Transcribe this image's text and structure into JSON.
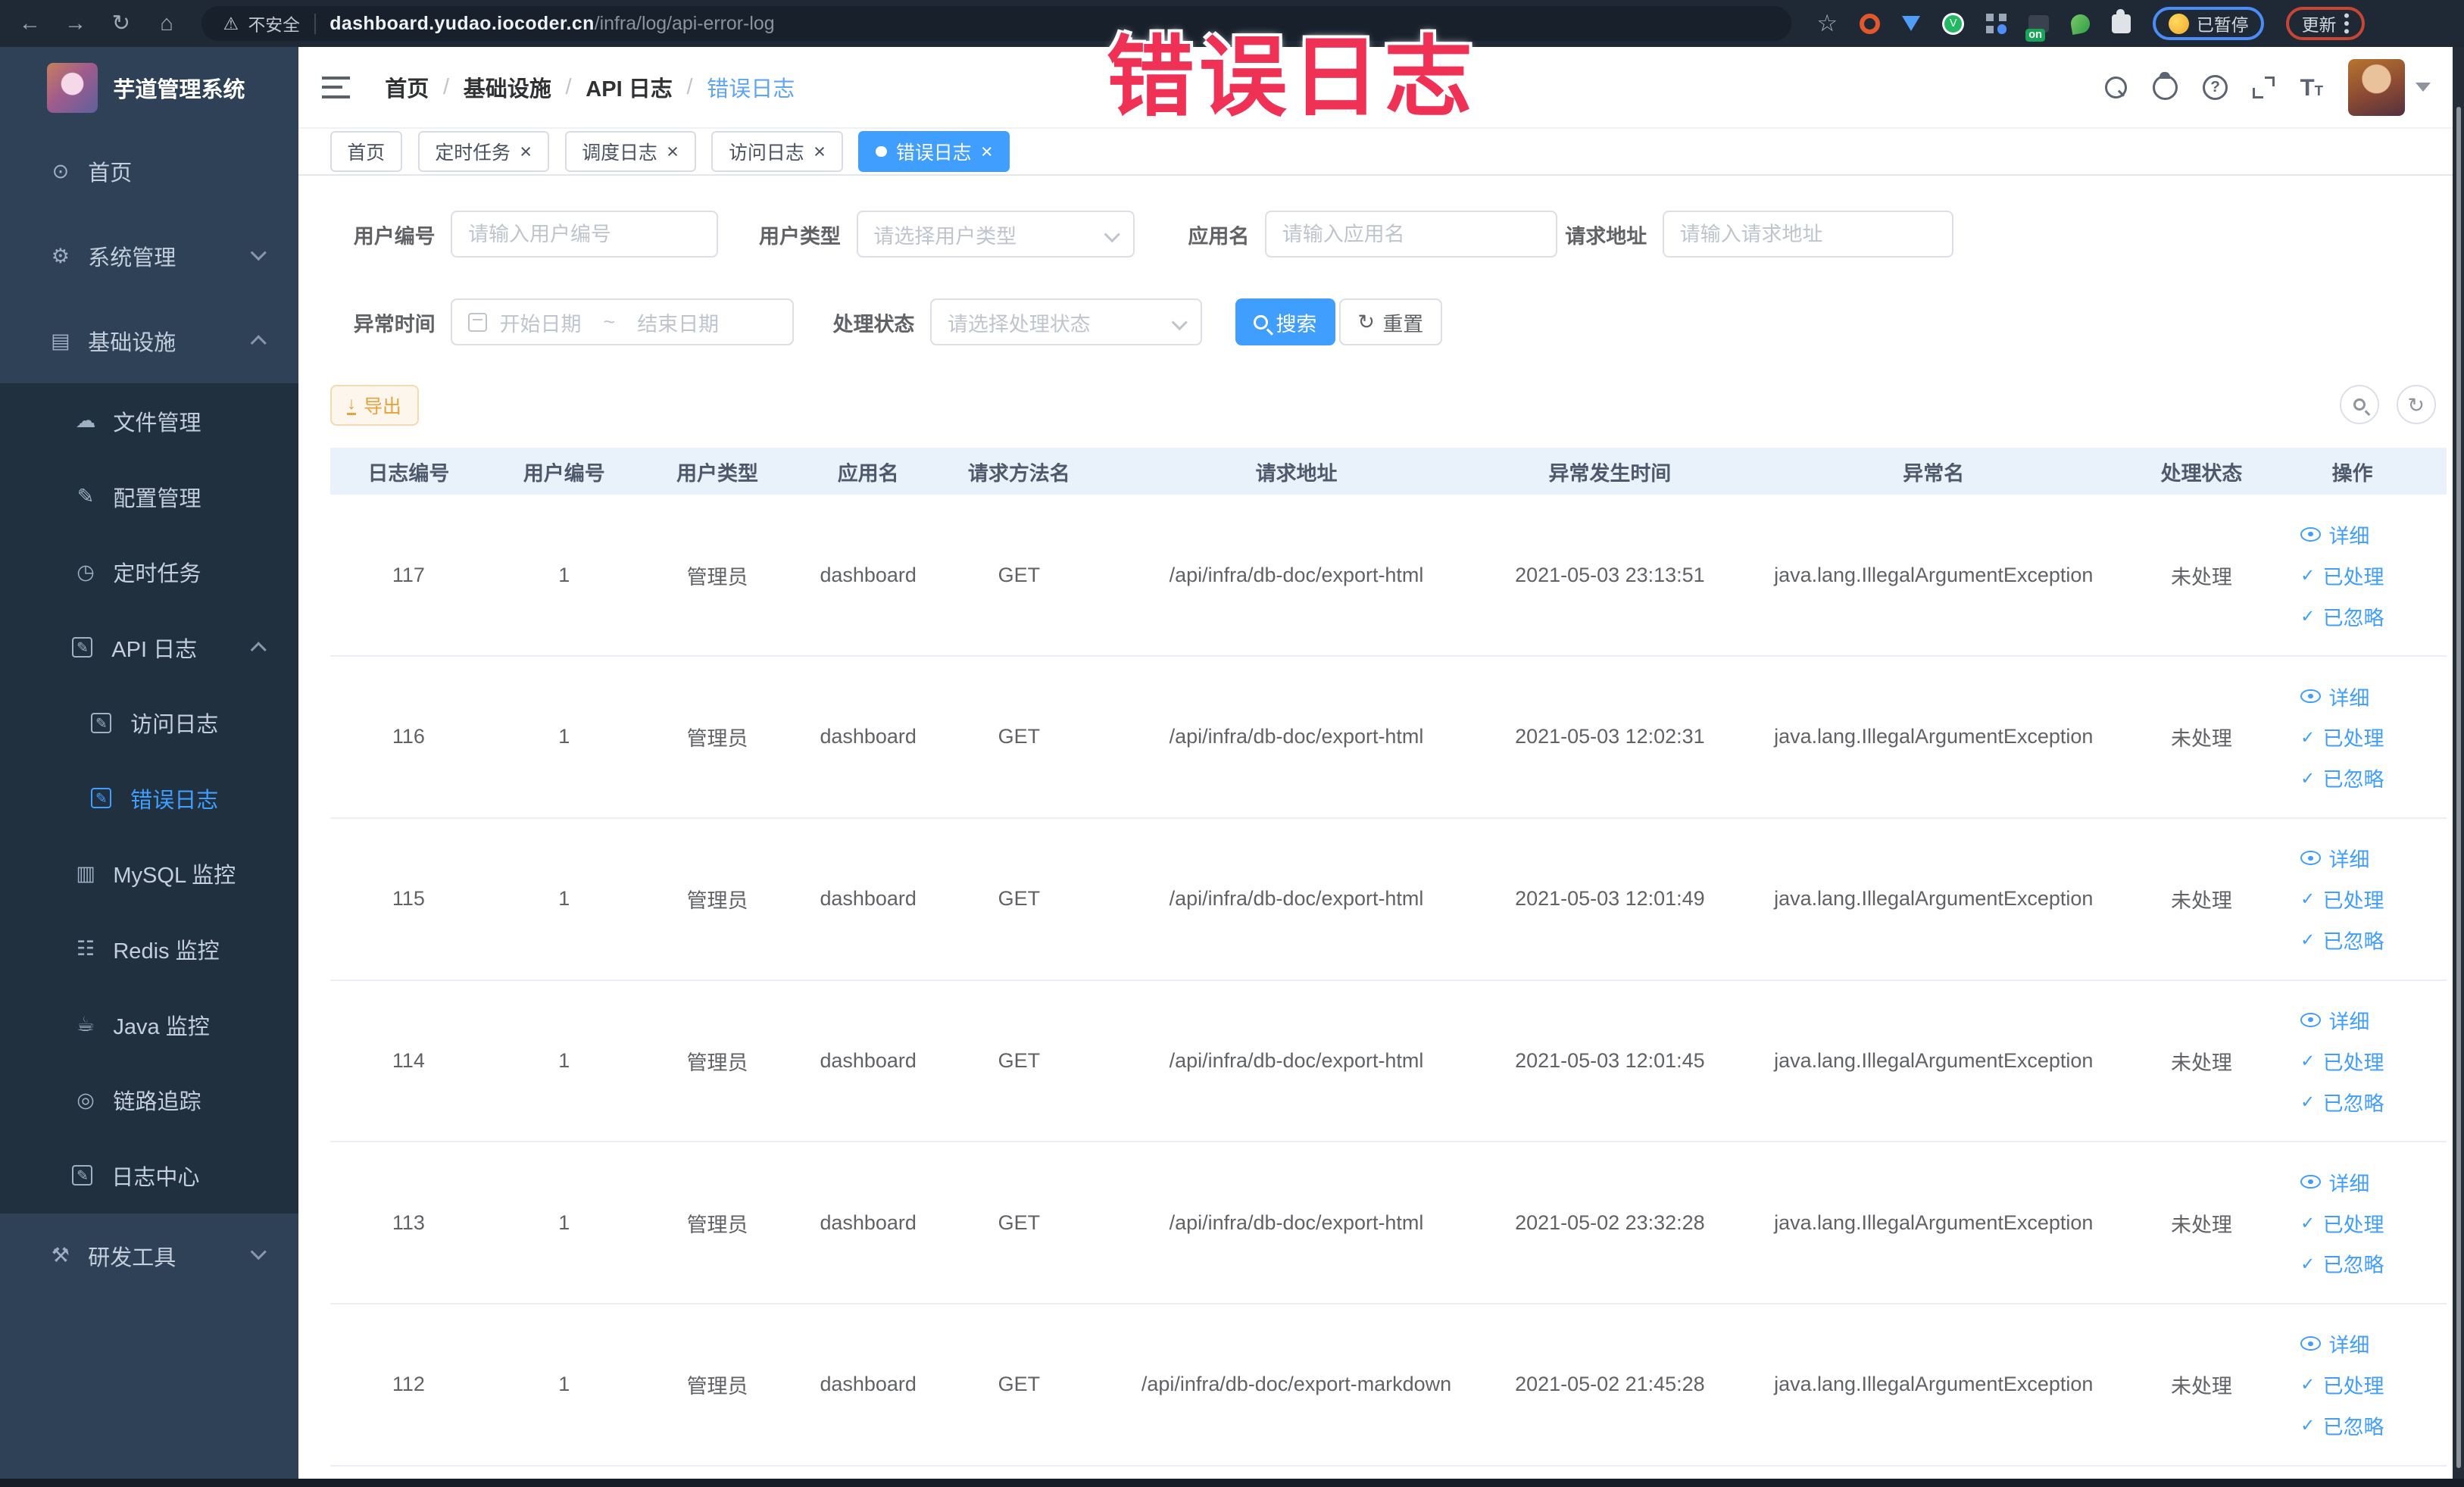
{
  "browser": {
    "security_label": "不安全",
    "url_host": "dashboard.yudao.iocoder.cn",
    "url_path": "/infra/log/api-error-log",
    "ext_on_badge": "on",
    "paused_badge": "已暂停",
    "update_button": "更新"
  },
  "annotation": {
    "text": "错误日志",
    "color": "#ef3156"
  },
  "sidebar": {
    "app_title": "芋道管理系统",
    "menu": [
      {
        "label": "首页",
        "icon": "home-icon",
        "level": 1
      },
      {
        "label": "系统管理",
        "icon": "gear-icon",
        "level": 1,
        "chevron": "down"
      },
      {
        "label": "基础设施",
        "icon": "infra-icon",
        "level": 1,
        "chevron": "up"
      },
      {
        "label": "文件管理",
        "icon": "file-icon",
        "level": 2,
        "sub": true
      },
      {
        "label": "配置管理",
        "icon": "config-icon",
        "level": 2,
        "sub": true
      },
      {
        "label": "定时任务",
        "icon": "job-icon",
        "level": 2,
        "sub": true
      },
      {
        "label": "API 日志",
        "icon": "log-icon",
        "level": 2,
        "sub": true,
        "chevron": "up"
      },
      {
        "label": "访问日志",
        "icon": "log-icon",
        "level": 3,
        "sub": true
      },
      {
        "label": "错误日志",
        "icon": "log-icon",
        "level": 3,
        "sub": true,
        "active": true
      },
      {
        "label": "MySQL 监控",
        "icon": "mysql-icon",
        "level": 2,
        "sub": true
      },
      {
        "label": "Redis 监控",
        "icon": "redis-icon",
        "level": 2,
        "sub": true
      },
      {
        "label": "Java 监控",
        "icon": "java-icon",
        "level": 2,
        "sub": true
      },
      {
        "label": "链路追踪",
        "icon": "trace-icon",
        "level": 2,
        "sub": true
      },
      {
        "label": "日志中心",
        "icon": "log-icon",
        "level": 2,
        "sub": true
      },
      {
        "label": "研发工具",
        "icon": "tools-icon",
        "level": 1,
        "chevron": "down"
      }
    ]
  },
  "breadcrumb": {
    "items": [
      "首页",
      "基础设施",
      "API 日志",
      "错误日志"
    ]
  },
  "tabs": [
    {
      "label": "首页",
      "closable": false,
      "active": false
    },
    {
      "label": "定时任务",
      "closable": true,
      "active": false
    },
    {
      "label": "调度日志",
      "closable": true,
      "active": false
    },
    {
      "label": "访问日志",
      "closable": true,
      "active": false
    },
    {
      "label": "错误日志",
      "closable": true,
      "active": true
    }
  ],
  "filters": {
    "user_id": {
      "label": "用户编号",
      "placeholder": "请输入用户编号"
    },
    "user_type": {
      "label": "用户类型",
      "placeholder": "请选择用户类型"
    },
    "app_name": {
      "label": "应用名",
      "placeholder": "请输入应用名"
    },
    "request_url": {
      "label": "请求地址",
      "placeholder": "请输入请求地址"
    },
    "exception_time": {
      "label": "异常时间",
      "start_placeholder": "开始日期",
      "separator": "~",
      "end_placeholder": "结束日期"
    },
    "process_status": {
      "label": "处理状态",
      "placeholder": "请选择处理状态"
    },
    "search_button": "搜索",
    "reset_button": "重置"
  },
  "toolbar": {
    "export_button": "导出"
  },
  "table": {
    "columns": [
      "日志编号",
      "用户编号",
      "用户类型",
      "应用名",
      "请求方法名",
      "请求地址",
      "异常发生时间",
      "异常名",
      "处理状态",
      "操作"
    ],
    "row_actions": [
      {
        "name": "detail",
        "icon": "eye-icon",
        "label": "详细"
      },
      {
        "name": "processed",
        "icon": "check-icon",
        "label": "已处理"
      },
      {
        "name": "ignored",
        "icon": "check-icon",
        "label": "已忽略"
      }
    ],
    "rows": [
      {
        "id": "117",
        "user_id": "1",
        "user_type": "管理员",
        "app": "dashboard",
        "method": "GET",
        "url": "/api/infra/db-doc/export-html",
        "time": "2021-05-03 23:13:51",
        "exception": "java.lang.IllegalArgumentException",
        "status": "未处理"
      },
      {
        "id": "116",
        "user_id": "1",
        "user_type": "管理员",
        "app": "dashboard",
        "method": "GET",
        "url": "/api/infra/db-doc/export-html",
        "time": "2021-05-03 12:02:31",
        "exception": "java.lang.IllegalArgumentException",
        "status": "未处理"
      },
      {
        "id": "115",
        "user_id": "1",
        "user_type": "管理员",
        "app": "dashboard",
        "method": "GET",
        "url": "/api/infra/db-doc/export-html",
        "time": "2021-05-03 12:01:49",
        "exception": "java.lang.IllegalArgumentException",
        "status": "未处理"
      },
      {
        "id": "114",
        "user_id": "1",
        "user_type": "管理员",
        "app": "dashboard",
        "method": "GET",
        "url": "/api/infra/db-doc/export-html",
        "time": "2021-05-03 12:01:45",
        "exception": "java.lang.IllegalArgumentException",
        "status": "未处理"
      },
      {
        "id": "113",
        "user_id": "1",
        "user_type": "管理员",
        "app": "dashboard",
        "method": "GET",
        "url": "/api/infra/db-doc/export-html",
        "time": "2021-05-02 23:32:28",
        "exception": "java.lang.IllegalArgumentException",
        "status": "未处理"
      },
      {
        "id": "112",
        "user_id": "1",
        "user_type": "管理员",
        "app": "dashboard",
        "method": "GET",
        "url": "/api/infra/db-doc/export-markdown",
        "time": "2021-05-02 21:45:28",
        "exception": "java.lang.IllegalArgumentException",
        "status": "未处理"
      }
    ]
  },
  "colors": {
    "primary": "#409eff",
    "warning": "#e6a23c",
    "sidebar_bg": "#2e4156",
    "submenu_bg": "#20303f",
    "table_header_bg": "#e9f1fb"
  }
}
